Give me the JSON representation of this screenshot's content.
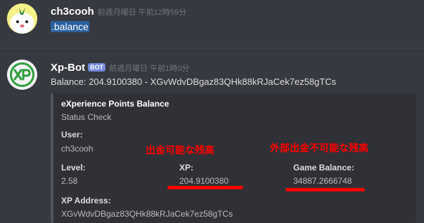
{
  "message1": {
    "username": "ch3cooh",
    "timestamp": "前週月曜日 午前12時59分",
    "content": ".balance"
  },
  "message2": {
    "username": "Xp-Bot",
    "bot_badge": "BOT",
    "timestamp": "前週月曜日 午前1時0分",
    "content": "Balance: 204.9100380 - XGvWdvDBgaz83QHk88kRJaCek7ez58gTCs",
    "embed": {
      "title": "eXperience Points Balance",
      "description": "Status Check",
      "fields": {
        "user": {
          "name": "User:",
          "value": "ch3cooh"
        },
        "level": {
          "name": "Level:",
          "value": "2.58"
        },
        "xp": {
          "name": "XP:",
          "value": "204.9100380"
        },
        "game_balance": {
          "name": "Game Balance:",
          "value": "34887.2666748"
        },
        "xp_address": {
          "name": "XP Address:",
          "value": "XGvWdvDBgaz83QHk88kRJaCek7ez58gTCs"
        }
      }
    }
  },
  "annotations": {
    "withdrawable": "出金可能な残高",
    "not_withdrawable": "外部出金不可能な残高"
  },
  "colors": {
    "background": "#36393f",
    "embed_bg": "#2f3136",
    "annotation": "#ff0000",
    "bot_badge": "#7289da",
    "selection": "#2a5f9e"
  },
  "icons": {
    "ch3cooh_avatar": "cartoon-character-avatar",
    "xpbot_avatar": "xp-logo-avatar"
  }
}
